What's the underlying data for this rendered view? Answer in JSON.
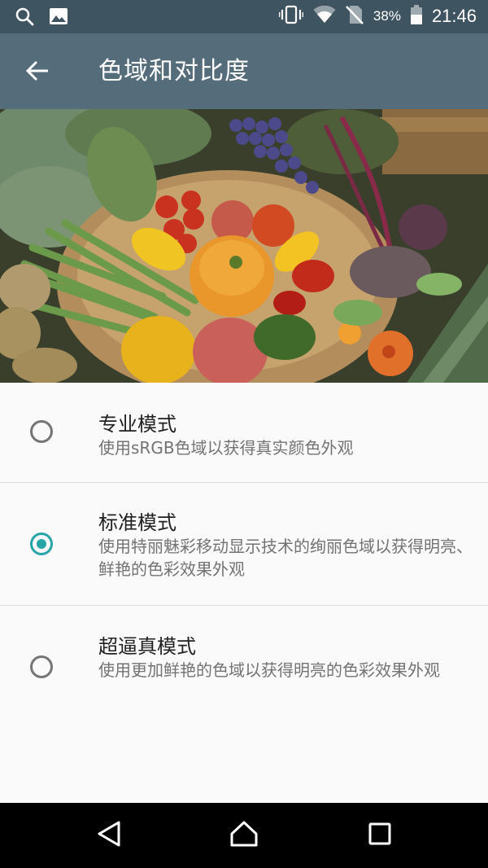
{
  "status_bar": {
    "battery_percent": "38%",
    "time": "21:46",
    "icons": [
      "search-icon",
      "image-icon",
      "vibrate-icon",
      "wifi-icon",
      "no-sim-icon",
      "battery-icon"
    ]
  },
  "app_bar": {
    "title": "色域和对比度",
    "back_icon": "arrow-back-icon"
  },
  "hero_image": {
    "subject": "vegetables-basket-photo"
  },
  "options": [
    {
      "title": "专业模式",
      "description": "使用sRGB色域以获得真实颜色外观",
      "selected": false
    },
    {
      "title": "标准模式",
      "description": "使用特丽魅彩移动显示技术的绚丽色域以获得明亮、鲜艳的色彩效果外观",
      "selected": true
    },
    {
      "title": "超逼真模式",
      "description": "使用更加鲜艳的色域以获得明亮的色彩效果外观",
      "selected": false
    }
  ],
  "colors": {
    "status_bar": "#3f5461",
    "app_bar": "#556c7b",
    "accent": "#26a5a6",
    "background": "#fafafa"
  },
  "nav_bar": {
    "icons": [
      "back-triangle-icon",
      "home-icon",
      "recents-square-icon"
    ]
  }
}
